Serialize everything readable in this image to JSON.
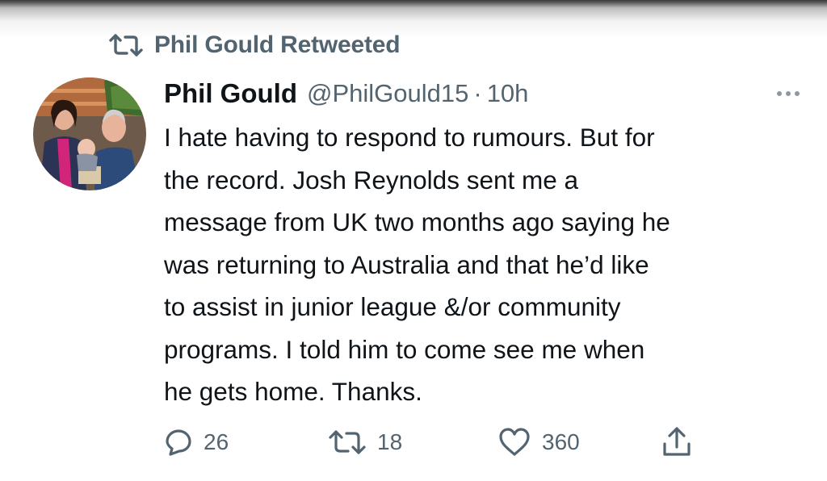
{
  "retweet_context": {
    "label": "Phil Gould Retweeted",
    "icon": "retweet-icon"
  },
  "tweet": {
    "author": {
      "name": "Phil Gould",
      "handle": "@PhilGould15",
      "avatar": "avatar-photo"
    },
    "separator": "·",
    "timestamp": "10h",
    "text_lines": [
      "I hate having to respond to rumours. But for",
      "the record. Josh Reynolds sent me a",
      "message from UK two months ago saying he",
      "was returning to Australia and that he’d like",
      "to assist in junior league &/or community",
      "programs. I told him to come see me when",
      "he gets home. Thanks."
    ],
    "more_icon": "more-icon"
  },
  "actions": {
    "reply": {
      "icon": "reply-icon",
      "count": "26"
    },
    "retweet": {
      "icon": "retweet-icon",
      "count": "18"
    },
    "like": {
      "icon": "heart-icon",
      "count": "360"
    },
    "share": {
      "icon": "share-icon"
    }
  },
  "colors": {
    "text_primary": "#0f1419",
    "text_secondary": "#536471",
    "background": "#ffffff"
  }
}
